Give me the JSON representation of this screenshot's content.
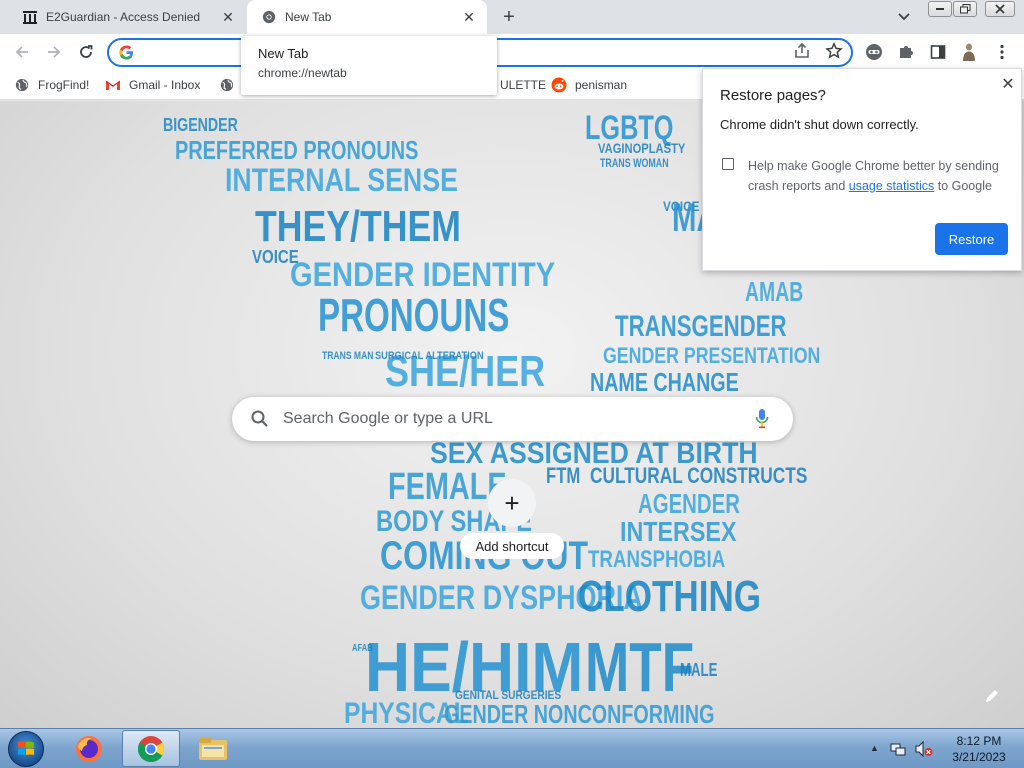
{
  "tabs": [
    {
      "title": "E2Guardian - Access Denied",
      "active": false
    },
    {
      "title": "New Tab",
      "active": true
    }
  ],
  "hover_card": {
    "title": "New Tab",
    "url": "chrome://newtab"
  },
  "omnibox": {
    "value": ""
  },
  "bookmarks": [
    {
      "label": "FrogFind!"
    },
    {
      "label": "Gmail - Inbox"
    },
    {
      "label": ""
    },
    {
      "label": "ULETTE"
    },
    {
      "label": "penisman"
    }
  ],
  "ntp": {
    "search_placeholder": "Search Google or type a URL",
    "add_shortcut_label": "Add shortcut",
    "background_words": [
      "BIGENDER",
      "PREFERRED PRONOUNS",
      "INTERNAL SENSE",
      "THEY/THEM",
      "GENDER IDENTITY",
      "PRONOUNS",
      "SHE/HER",
      "TRANS MAN",
      "SURGICAL ALTERATION",
      "SEX ASSIGNED AT BIRTH",
      "FEMALE",
      "FTM",
      "CULTURAL CONSTRUCTS",
      "BODY SHAPE",
      "AGENDER",
      "INTERSEX",
      "COMING OUT",
      "TRANSPHOBIA",
      "GENDER DYSPHORIA",
      "CLOTHING",
      "HE/HIM",
      "MTF",
      "PHYSICAL",
      "GENDER NONCONFORMING",
      "GENITAL SURGERIES",
      "LGBTQ",
      "VAGINOPLASTY",
      "TRANS WOMAN",
      "TRANSGENDER",
      "GENDER PRESENTATION",
      "NAME CHANGE",
      "AMAB",
      "AFAB",
      "MALE",
      "VOICE"
    ]
  },
  "restore_dialog": {
    "title": "Restore pages?",
    "message": "Chrome didn't shut down correctly.",
    "checkbox_text_before": "Help make Google Chrome better by sending crash reports and",
    "checkbox_link": "usage statistics",
    "checkbox_text_after": "to Google",
    "restore_label": "Restore"
  },
  "taskbar": {
    "time": "8:12 PM",
    "date": "3/21/2023"
  }
}
